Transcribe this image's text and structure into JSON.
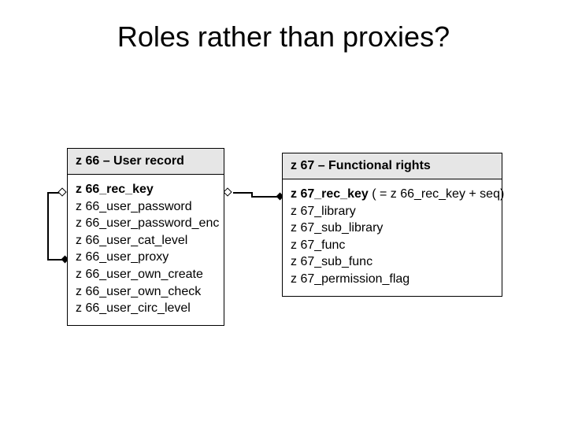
{
  "title": "Roles rather than proxies?",
  "left_box": {
    "header": "z 66 – User record",
    "fields": [
      {
        "name": "z 66_rec_key",
        "key": true
      },
      {
        "name": "z 66_user_password"
      },
      {
        "name": "z 66_user_password_enc"
      },
      {
        "name": "z 66_user_cat_level"
      },
      {
        "name": "z 66_user_proxy"
      },
      {
        "name": "z 66_user_own_create"
      },
      {
        "name": "z 66_user_own_check"
      },
      {
        "name": "z 66_user_circ_level"
      }
    ]
  },
  "right_box": {
    "header": "z 67 – Functional rights",
    "fields": [
      {
        "name": "z 67_rec_key",
        "key": true,
        "note": "  ( = z 66_rec_key + seq)"
      },
      {
        "name": "z 67_library"
      },
      {
        "name": "z 67_sub_library"
      },
      {
        "name": "z 67_func"
      },
      {
        "name": "z 67_sub_func"
      },
      {
        "name": "z 67_permission_flag"
      }
    ]
  }
}
